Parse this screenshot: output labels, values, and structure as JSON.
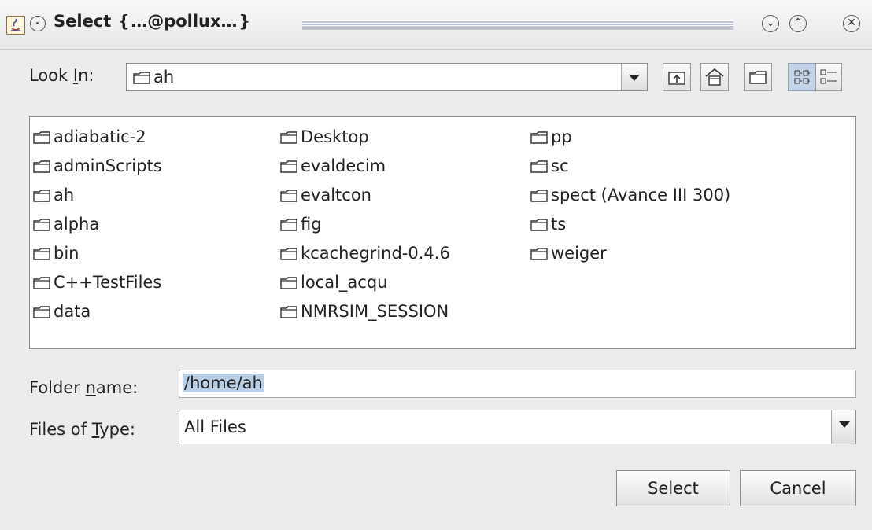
{
  "window": {
    "title": "Select ❴…@pollux…❵",
    "icons": [
      "java-icon",
      "window-menu-icon",
      "minimize-icon",
      "maximize-icon",
      "close-icon"
    ]
  },
  "look_in": {
    "label_before": "Look ",
    "mnemonic": "I",
    "label_after": "n:",
    "value": "ah"
  },
  "toolbar": {
    "buttons": [
      "up-folder-icon",
      "home-icon",
      "new-folder-icon",
      "list-view-icon",
      "details-view-icon"
    ]
  },
  "files": {
    "columns": [
      [
        "adiabatic-2",
        "adminScripts",
        "ah",
        "alpha",
        "bin",
        "C++TestFiles",
        "data"
      ],
      [
        "Desktop",
        "evaldecim",
        "evaltcon",
        "fig",
        "kcachegrind-0.4.6",
        "local_acqu",
        "NMRSIM_SESSION"
      ],
      [
        "pp",
        "sc",
        "spect (Avance III 300)",
        "ts",
        "weiger"
      ]
    ]
  },
  "folder_name": {
    "label_before": "Folder ",
    "mnemonic": "n",
    "label_after": "ame:",
    "value": "/home/ah"
  },
  "files_of_type": {
    "label_before": "Files of ",
    "mnemonic": "T",
    "label_after": "ype:",
    "value": "All Files"
  },
  "buttons": {
    "select": "Select",
    "cancel": "Cancel"
  }
}
